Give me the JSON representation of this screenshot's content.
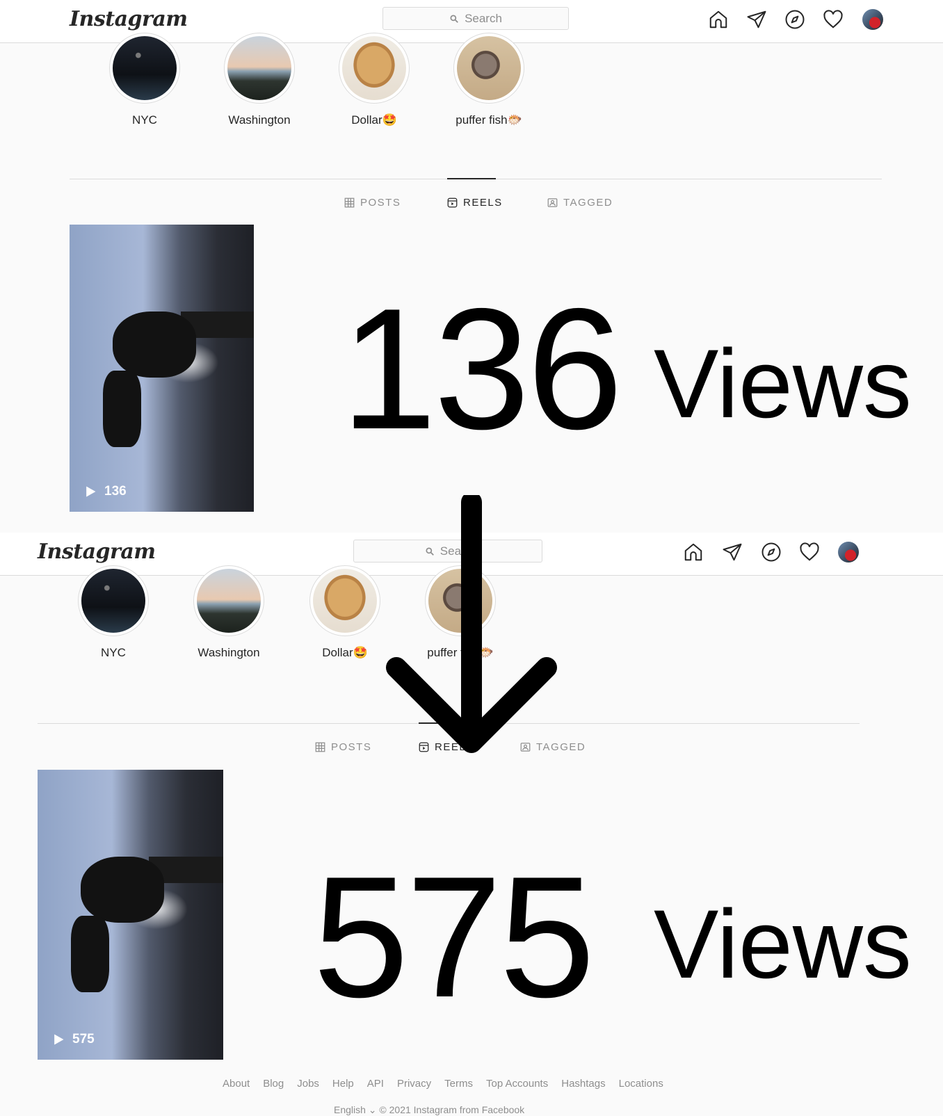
{
  "app": {
    "name": "Instagram"
  },
  "search": {
    "placeholder": "Search",
    "placeholder_cut": "Searc"
  },
  "highlights": [
    {
      "label": "NYC"
    },
    {
      "label": "Washington"
    },
    {
      "label": "Dollar🤩"
    },
    {
      "label": "puffer fish🐡"
    }
  ],
  "tabs": {
    "posts": "POSTS",
    "reels": "REELS",
    "tagged": "TAGGED",
    "reels_cut": "REEL"
  },
  "before": {
    "play_count": "136",
    "big_number": "136",
    "big_word": "Views"
  },
  "after": {
    "play_count": "575",
    "big_number": "575",
    "big_word": "Views"
  },
  "footer": {
    "links": [
      "About",
      "Blog",
      "Jobs",
      "Help",
      "API",
      "Privacy",
      "Terms",
      "Top Accounts",
      "Hashtags",
      "Locations"
    ],
    "bottom": "English ⌄   © 2021 Instagram from Facebook"
  }
}
